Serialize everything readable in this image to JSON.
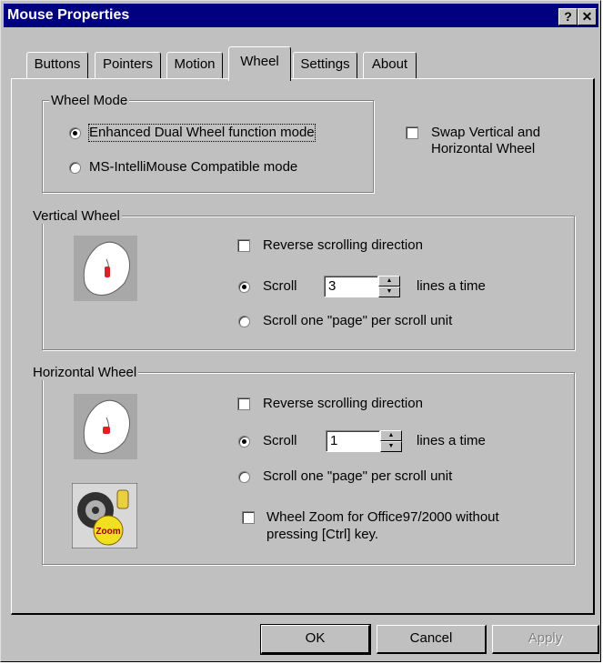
{
  "window": {
    "title": "Mouse Properties",
    "help_button": "?",
    "close_button": "✕"
  },
  "tabs": [
    {
      "label": "Buttons"
    },
    {
      "label": "Pointers"
    },
    {
      "label": "Motion"
    },
    {
      "label": "Wheel",
      "active": true
    },
    {
      "label": "Settings"
    },
    {
      "label": "About"
    }
  ],
  "wheel_mode": {
    "group_label": "Wheel Mode",
    "options": [
      {
        "label": "Enhanced Dual Wheel function mode",
        "selected": true
      },
      {
        "label": "MS-IntelliMouse Compatible mode",
        "selected": false
      }
    ],
    "swap_label_line1": "Swap Vertical and",
    "swap_label_line2": "Horizontal Wheel",
    "swap_checked": false
  },
  "vertical_wheel": {
    "group_label": "Vertical Wheel",
    "reverse_label": "Reverse scrolling direction",
    "reverse_checked": false,
    "scroll_label": "Scroll",
    "scroll_selected": true,
    "lines_value": "3",
    "lines_suffix": "lines a time",
    "page_label": "Scroll one \"page\" per scroll unit",
    "page_selected": false
  },
  "horizontal_wheel": {
    "group_label": "Horizontal Wheel",
    "reverse_label": "Reverse scrolling direction",
    "reverse_checked": false,
    "scroll_label": "Scroll",
    "scroll_selected": true,
    "lines_value": "1",
    "lines_suffix": "lines a time",
    "page_label": "Scroll one \"page\" per scroll unit",
    "page_selected": false,
    "zoom_label_line1": "Wheel Zoom for Office97/2000 without",
    "zoom_label_line2": "pressing [Ctrl] key.",
    "zoom_checked": false,
    "zoom_icon_text": "Zoom"
  },
  "buttons": {
    "ok": "OK",
    "cancel": "Cancel",
    "apply": "Apply"
  },
  "colors": {
    "face": "#c0c0c0",
    "titlebar": "#000080",
    "mouse_accent": "#e02020"
  }
}
